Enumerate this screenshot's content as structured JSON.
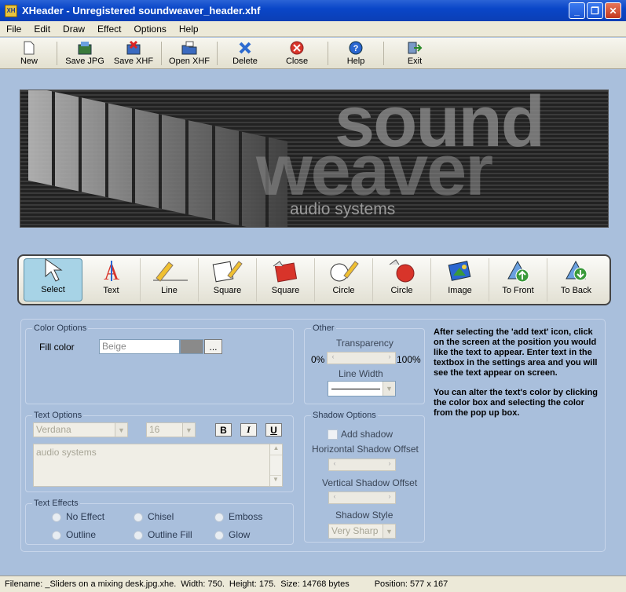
{
  "window": {
    "title": "XHeader - Unregistered soundweaver_header.xhf",
    "app_icon": "XH",
    "minimize": "_",
    "maximize": "❐",
    "close": "✕"
  },
  "menu": [
    "File",
    "Edit",
    "Draw",
    "Effect",
    "Options",
    "Help"
  ],
  "toolbar": [
    {
      "label": "New",
      "icon": "new-document-icon"
    },
    {
      "label": "Save JPG",
      "icon": "save-jpg-icon"
    },
    {
      "label": "Save XHF",
      "icon": "save-xhf-icon"
    },
    {
      "label": "Open XHF",
      "icon": "open-folder-icon"
    },
    {
      "label": "Delete",
      "icon": "delete-x-icon"
    },
    {
      "label": "Close",
      "icon": "close-circle-icon"
    },
    {
      "label": "Help",
      "icon": "help-icon"
    },
    {
      "label": "Exit",
      "icon": "exit-icon"
    }
  ],
  "banner": {
    "word1": "sound",
    "word2": "weaver",
    "subtitle": "audio systems"
  },
  "tools": [
    "Select",
    "Text",
    "Line",
    "Square",
    "Square",
    "Circle",
    "Circle",
    "Image",
    "To Front",
    "To Back"
  ],
  "color_options": {
    "legend": "Color Options",
    "fill_label": "Fill color",
    "fill_value": "Beige",
    "browse": "..."
  },
  "other": {
    "legend": "Other",
    "transparency_label": "Transparency",
    "min": "0%",
    "max": "100%",
    "line_width_label": "Line Width"
  },
  "text_options": {
    "legend": "Text Options",
    "font": "Verdana",
    "size": "16",
    "bold": "B",
    "italic": "I",
    "underline": "U",
    "text": "audio systems"
  },
  "shadow_options": {
    "legend": "Shadow Options",
    "add_shadow": "Add shadow",
    "h_offset": "Horizontal Shadow Offset",
    "v_offset": "Vertical Shadow Offset",
    "style_label": "Shadow Style",
    "style_value": "Very Sharp"
  },
  "text_effects": {
    "legend": "Text Effects",
    "options": [
      "No Effect",
      "Chisel",
      "Emboss",
      "Outline",
      "Outline Fill",
      "Glow"
    ]
  },
  "info": {
    "p1": "After selecting the 'add text' icon, click on the screen at the position you would like the text to appear. Enter text in the textbox in the settings area and you will see the text appear on screen.",
    "p2": "You can alter the text's color by clicking the color box and selecting the color from the pop up box."
  },
  "status": {
    "filename": "Filename: _Sliders on a mixing desk.jpg.xhe.",
    "width": "Width: 750.",
    "height": "Height: 175.",
    "size": "Size: 14768 bytes",
    "position": "Position: 577 x 167"
  }
}
